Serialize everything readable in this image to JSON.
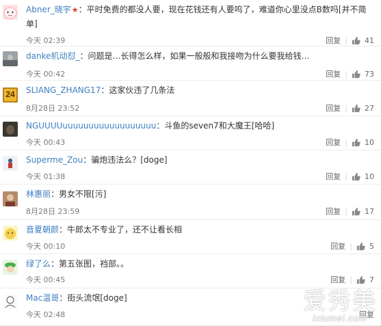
{
  "comments": [
    {
      "author": "Abner_晓宇",
      "vip_badge": true,
      "text": "平时免费的都没人要，现在花钱还有人要呜了，难道你心里没点B数吗[并不简单]",
      "time": "今天 02:39",
      "reply_label": "回复",
      "likes": "41",
      "avatar_icon": "face-sticker-avatar"
    },
    {
      "author": "danke机动怼_",
      "text": "问题是…长得怎么样，如果一般般和我接吻为什么要我给钱…",
      "time": "今天 00:42",
      "reply_label": "回复",
      "likes": "73",
      "avatar_icon": "photo-avatar"
    },
    {
      "author": "SLIANG_ZHANG17",
      "text": "这家伙违了几条法",
      "time": "8月28日 23:52",
      "reply_label": "回复",
      "likes": "27",
      "avatar_icon": "number-24-avatar",
      "avatar_text": "24"
    },
    {
      "author": "NGUUUUuuuuuuuuuuuuuuuuuu",
      "text": "斗鱼的seven7和大魔王[哈哈]",
      "time": "今天 00:43",
      "reply_label": "回复",
      "likes": "10",
      "avatar_icon": "dark-photo-avatar"
    },
    {
      "author": "Superme_Zou",
      "text": "骗炮违法么？[doge]",
      "time": "今天 01:38",
      "reply_label": "回复",
      "likes": "10",
      "avatar_icon": "figure-avatar"
    },
    {
      "author": "林惠丽",
      "text": "男女不限[污]",
      "time": "8月28日 23:59",
      "reply_label": "回复",
      "likes": "17",
      "avatar_icon": "portrait-avatar"
    },
    {
      "author": "音夏朝颜",
      "text": "牛郎太不专业了，还不让看长相",
      "time": "今天 00:10",
      "reply_label": "回复",
      "likes": "5",
      "avatar_icon": "yellow-cartoon-avatar"
    },
    {
      "author": "绿了么",
      "text": "第五张图，裆部。。",
      "time": "今天 00:45",
      "reply_label": "回复",
      "likes": "7",
      "avatar_icon": "green-cartoon-avatar"
    },
    {
      "author": "Mac温哥",
      "text": "街头流氓[doge]",
      "time": "今天 02:48",
      "reply_label": "回复",
      "likes": "",
      "avatar_icon": "sketch-avatar"
    }
  ],
  "watermark": {
    "cn": "爱秀美",
    "en": "ixiumei.com"
  },
  "colors": {
    "author": "#3e7fc1",
    "time": "#7a7a7a",
    "divider": "#ececec"
  }
}
